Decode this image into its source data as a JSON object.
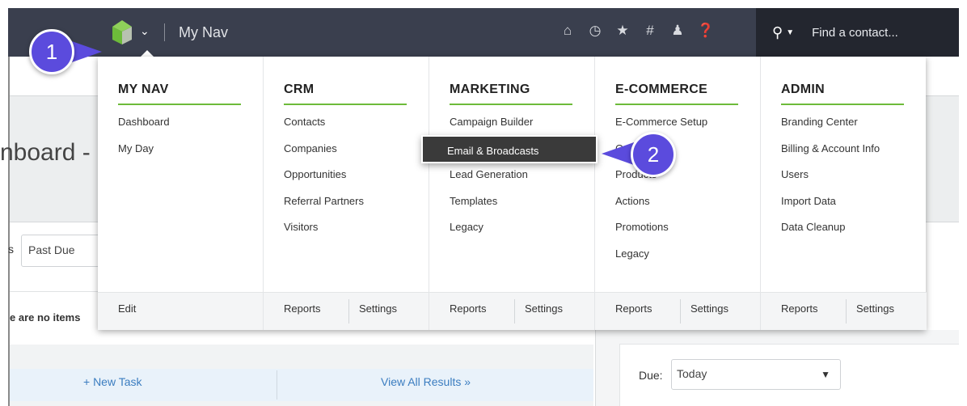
{
  "topbar": {
    "title": "My Nav",
    "search_placeholder": "Find a contact...",
    "icons": [
      "home-icon",
      "history-icon",
      "star-icon",
      "hashtag-icon",
      "user-icon",
      "help-icon"
    ]
  },
  "background": {
    "page_heading_fragment": "nboard -",
    "filter_prefix": "s",
    "filter_value": "Past Due",
    "empty_text": "e are no items",
    "new_task": "+ New Task",
    "view_all": "View All Results »",
    "due_label": "Due:",
    "due_value": "Today"
  },
  "menu": {
    "columns": [
      {
        "heading": "MY NAV",
        "items": [
          "Dashboard",
          "My Day"
        ],
        "footer": [
          "Edit"
        ]
      },
      {
        "heading": "CRM",
        "items": [
          "Contacts",
          "Companies",
          "Opportunities",
          "Referral Partners",
          "Visitors"
        ],
        "footer": [
          "Reports",
          "Settings"
        ]
      },
      {
        "heading": "MARKETING",
        "items": [
          "Campaign Builder",
          "Email & Broadcasts",
          "Lead Generation",
          "Templates",
          "Legacy"
        ],
        "footer": [
          "Reports",
          "Settings"
        ]
      },
      {
        "heading": "E-COMMERCE",
        "items": [
          "E-Commerce Setup",
          "Orders",
          "Products",
          "Actions",
          "Promotions",
          "Legacy"
        ],
        "footer": [
          "Reports",
          "Settings"
        ]
      },
      {
        "heading": "ADMIN",
        "items": [
          "Branding Center",
          "Billing & Account Info",
          "Users",
          "Import Data",
          "Data Cleanup"
        ],
        "footer": [
          "Reports",
          "Settings"
        ]
      }
    ],
    "hovered_item": "Email & Broadcasts"
  },
  "callouts": {
    "step1": "1",
    "step2": "2"
  },
  "colors": {
    "topbar": "#3a3f4e",
    "accent_green": "#6dbb3a",
    "callout": "#5b4bdd"
  }
}
